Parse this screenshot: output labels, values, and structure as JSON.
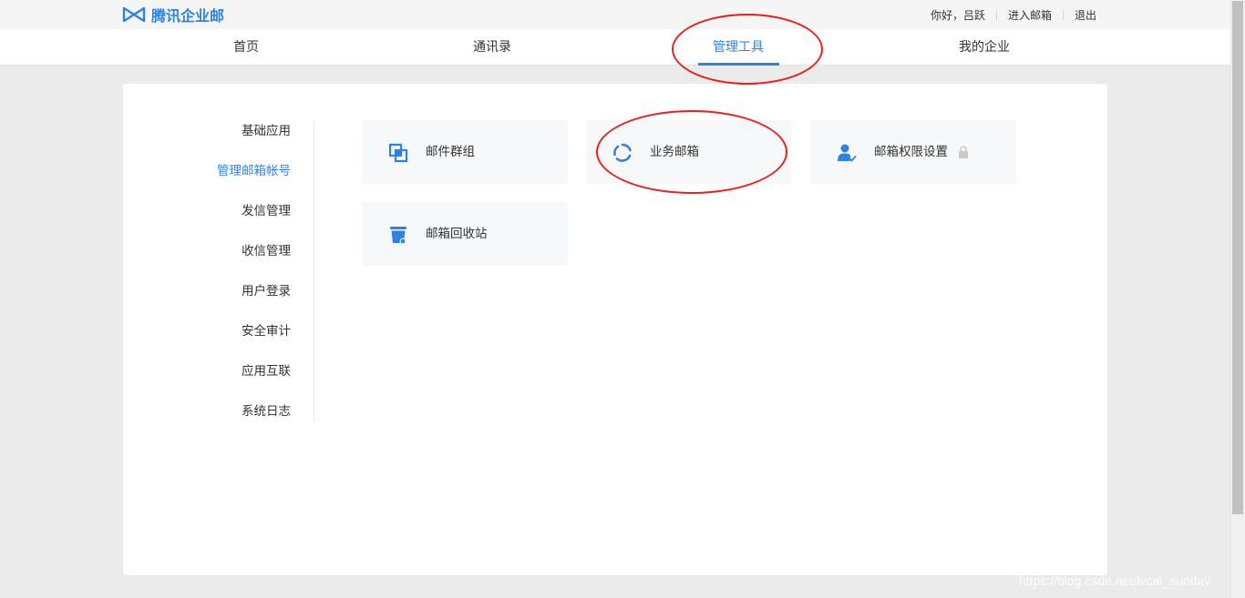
{
  "brand": {
    "name": "腾讯企业邮",
    "color": "#2f82e0"
  },
  "user_links": {
    "greeting": "你好，吕跃",
    "enter_mail": "进入邮箱",
    "logout": "退出"
  },
  "nav": {
    "items": [
      {
        "label": "首页"
      },
      {
        "label": "通讯录"
      },
      {
        "label": "管理工具",
        "active": true
      },
      {
        "label": "我的企业"
      }
    ]
  },
  "sidebar": {
    "items": [
      {
        "label": "基础应用"
      },
      {
        "label": "管理邮箱帐号",
        "active": true
      },
      {
        "label": "发信管理"
      },
      {
        "label": "收信管理"
      },
      {
        "label": "用户登录"
      },
      {
        "label": "安全审计"
      },
      {
        "label": "应用互联"
      },
      {
        "label": "系统日志"
      }
    ]
  },
  "cards": [
    {
      "label": "邮件群组",
      "icon": "mail-group-icon"
    },
    {
      "label": "业务邮箱",
      "icon": "business-mailbox-icon"
    },
    {
      "label": "邮箱权限设置",
      "icon": "mailbox-permission-icon",
      "locked": true
    },
    {
      "label": "邮箱回收站",
      "icon": "recycle-bin-icon"
    }
  ],
  "annotation_color": "#e3231c",
  "watermark": "https://blog.csdn.net/lvcai_sunday"
}
